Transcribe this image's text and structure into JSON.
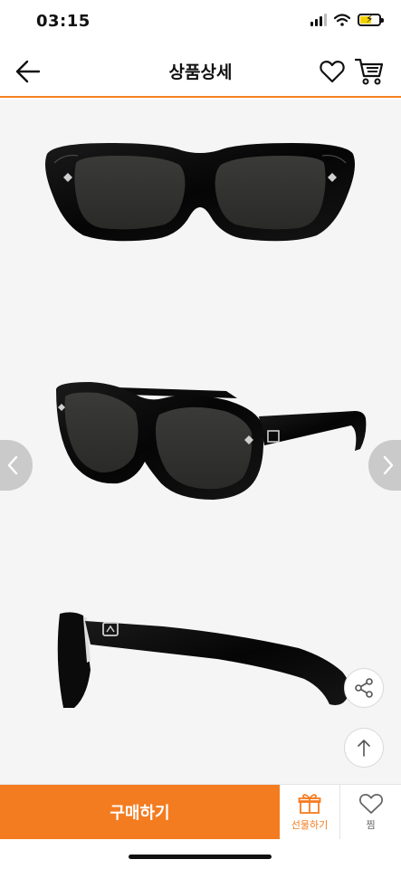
{
  "status_bar": {
    "time": "03:15"
  },
  "header": {
    "title": "상품상세",
    "back_icon": "arrow-left-icon",
    "wishlist_icon": "heart-outline-icon",
    "cart_icon": "shopping-cart-icon"
  },
  "gallery": {
    "views": [
      "front",
      "three-quarter",
      "side"
    ],
    "prev_icon": "chevron-left-icon",
    "next_icon": "chevron-right-icon"
  },
  "floating": {
    "share_icon": "share-icon",
    "top_icon": "arrow-up-icon"
  },
  "bottom_bar": {
    "buy_label": "구매하기",
    "gift_label": "선물하기",
    "wish_label": "찜"
  },
  "colors": {
    "accent": "#f47c20",
    "header_border": "#f58220",
    "gallery_bg": "#f5f5f5"
  }
}
